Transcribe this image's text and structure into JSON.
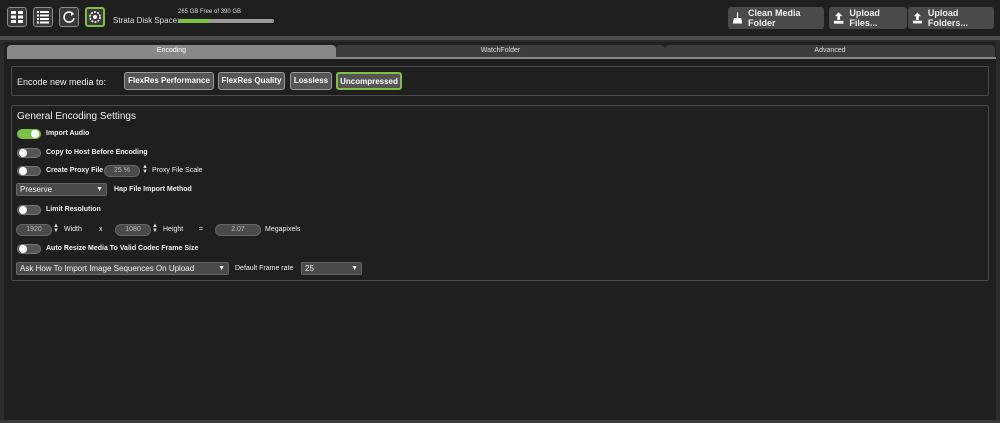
{
  "toolbar": {
    "icons": [
      "grid-icon",
      "list-icon",
      "refresh-icon",
      "settings-icon"
    ],
    "disk_label": "Strata Disk Space:",
    "disk_free_text": "265 GB Free of 390 GB",
    "disk_used_fraction": 0.32,
    "clean_media_label": "Clean Media Folder",
    "upload_files_label": "Upload Files...",
    "upload_folders_label": "Upload Folders..."
  },
  "tabs": [
    {
      "label": "Encoding",
      "active": true
    },
    {
      "label": "WatchFolder",
      "active": false
    },
    {
      "label": "Advanced",
      "active": false
    }
  ],
  "encode": {
    "label": "Encode new media to:",
    "presets": [
      {
        "label": "FlexRes Performance",
        "selected": false
      },
      {
        "label": "FlexRes Quality",
        "selected": false
      },
      {
        "label": "Lossless",
        "selected": false
      },
      {
        "label": "Uncompressed",
        "selected": true
      }
    ]
  },
  "general": {
    "title": "General Encoding Settings",
    "import_audio": {
      "label": "Import Audio",
      "on": true
    },
    "copy_to_host": {
      "label": "Copy to Host Before Encoding",
      "on": false
    },
    "create_proxy": {
      "label": "Create Proxy File",
      "on": false
    },
    "proxy_scale_value": "25 %",
    "proxy_scale_label": "Proxy File Scale",
    "hap_method_value": "Preserve",
    "hap_method_label": "Hap File Import Method",
    "limit_resolution": {
      "label": "Limit Resolution",
      "on": false
    },
    "width_value": "1920",
    "width_label": "Width",
    "x_label": "x",
    "height_value": "1080",
    "height_label": "Height",
    "equals_label": "=",
    "megapixels_value": "2.07",
    "megapixels_label": "Megapixels",
    "auto_resize": {
      "label": "Auto Resize Media To Valid Codec Frame Size",
      "on": false
    },
    "image_seq_value": "Ask How To Import Image Sequences On Upload",
    "frame_rate_label": "Default Frame rate",
    "frame_rate_value": "25"
  }
}
